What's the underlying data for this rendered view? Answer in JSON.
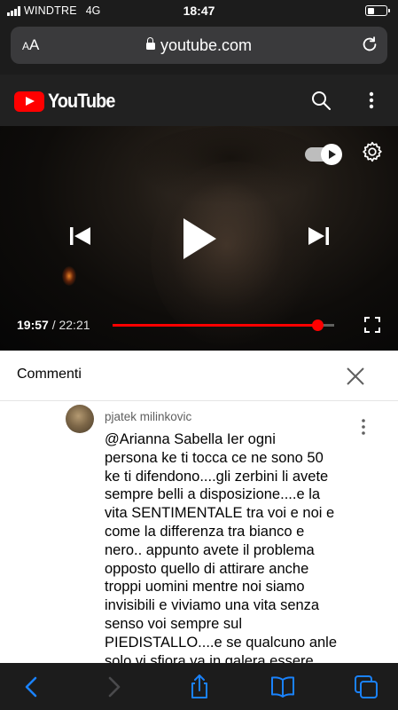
{
  "status_bar": {
    "carrier": "WINDTRE",
    "network": "4G",
    "time": "18:47",
    "battery_level": 0.35
  },
  "browser": {
    "aa_label": "AA",
    "url": "youtube.com"
  },
  "youtube": {
    "brand": "YouTube"
  },
  "player": {
    "current_time": "19:57",
    "separator": "/",
    "total_time": "22:21",
    "progress_fraction": 0.925,
    "autoplay_on": true
  },
  "comments": {
    "title": "Commenti",
    "items": [
      {
        "author": "pjatek milinkovic",
        "lines": [
          " @Arianna Sabella  Ier ogni",
          "persona ke ti tocca ce ne sono 50",
          "ke ti difendono....gli zerbini li avete",
          "sempre belli a disposizione....e la",
          "vita SENTIMENTALE tra voi e noi e",
          "come la differenza tra bianco e",
          "nero.. appunto avete il problema",
          "opposto quello di attirare anche",
          "troppi uomini mentre noi siamo",
          "invisibili e viviamo una vita senza",
          "senso voi sempre sul",
          "PIEDISTALLO....e se qualcuno anle",
          "solo vi sfiora va in galera essere"
        ]
      }
    ]
  },
  "colors": {
    "youtube_red": "#ff0000",
    "safari_bar": "#1c1c1c",
    "toolbar_blue": "#1a82fb"
  }
}
